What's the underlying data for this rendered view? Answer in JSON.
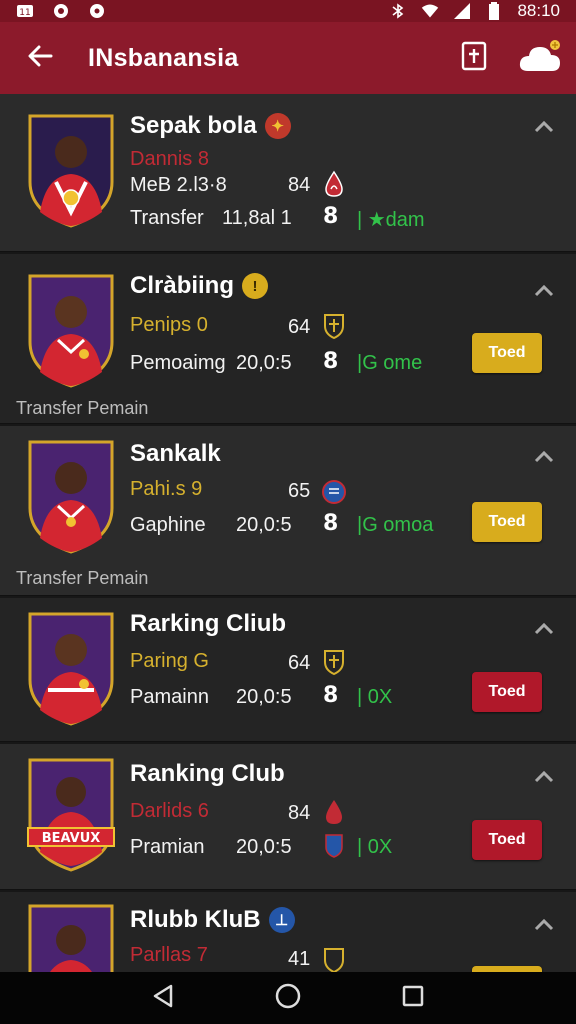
{
  "status_bar": {
    "time": "88:10",
    "icons": [
      "notification-icon",
      "app-icon",
      "circle-icon",
      "bluetooth-icon",
      "wifi-icon",
      "signal-icon",
      "battery-icon"
    ]
  },
  "app_bar": {
    "title": "INsbanansia",
    "back_icon": "arrow-left-icon",
    "actions": [
      "add-document-icon",
      "cloud-icon"
    ]
  },
  "section_labels": [
    "Transfer Pemain",
    "Transfer Pemain"
  ],
  "cards": [
    {
      "name": "Sepak bola",
      "name_icon_color": "#c0392b",
      "subtitle": "Dannis 8",
      "subtitle_color": "#c22b35",
      "row2_left": "MeB 2.l3·8",
      "number": "84",
      "row3_left": "Transfer",
      "row3_value": "11,8al 1",
      "tag": "| ★dam",
      "tag_color": "#32c24a",
      "badge_bg": "#2a1c4d",
      "button": ""
    },
    {
      "name": "Clràbiing",
      "name_icon_color": "#d8ac1d",
      "subtitle": "Penips 0",
      "subtitle_color": "#d6b12e",
      "row2_left": "",
      "number": "64",
      "row3_left": "Pemoaimg",
      "row3_value": "20,0:5",
      "tag": "|G ome",
      "tag_color": "#32c24a",
      "badge_bg": "#4a2370",
      "button": "Toed",
      "button_color": "yellow"
    },
    {
      "name": "Sankalk",
      "name_icon_color": "",
      "subtitle": "Pahi.s 9",
      "subtitle_color": "#d6b12e",
      "row2_left": "",
      "number": "65",
      "row3_left": "Gaphine",
      "row3_value": "20,0:5",
      "tag": "|G omoa",
      "tag_color": "#32c24a",
      "badge_bg": "#4a2370",
      "button": "Toed",
      "button_color": "yellow"
    },
    {
      "name": "Rarking Cliub",
      "name_icon_color": "",
      "subtitle": "Paring G",
      "subtitle_color": "#d6b12e",
      "row2_left": "",
      "number": "64",
      "row3_left": "Pamainn",
      "row3_value": "20,0:5",
      "tag": "| 0X",
      "tag_color": "#32c24a",
      "badge_bg": "#4a2370",
      "button": "Toed",
      "button_color": "red"
    },
    {
      "name": "Ranking Club",
      "name_icon_color": "",
      "subtitle": "Darlids 6",
      "subtitle_color": "#c22b35",
      "row2_left": "",
      "number": "84",
      "row3_left": "Pramian",
      "row3_value": "20,0:5",
      "tag": "| 0X",
      "tag_color": "#32c24a",
      "badge_bg": "#4a2370",
      "badge_banner": "BEAVUX",
      "button": "Toed",
      "button_color": "red"
    },
    {
      "name": "Rlubb KluB",
      "name_icon_color": "#2456a8",
      "subtitle": "Parllas 7",
      "subtitle_color": "#c22b35",
      "row2_left": "",
      "number": "41",
      "row3_left": "",
      "row3_value": "",
      "tag": "",
      "tag_color": "#32c24a",
      "badge_bg": "#4a2370",
      "button": ""
    }
  ],
  "nav_bar": [
    "back-triangle-icon",
    "home-circle-icon",
    "recents-square-icon"
  ]
}
